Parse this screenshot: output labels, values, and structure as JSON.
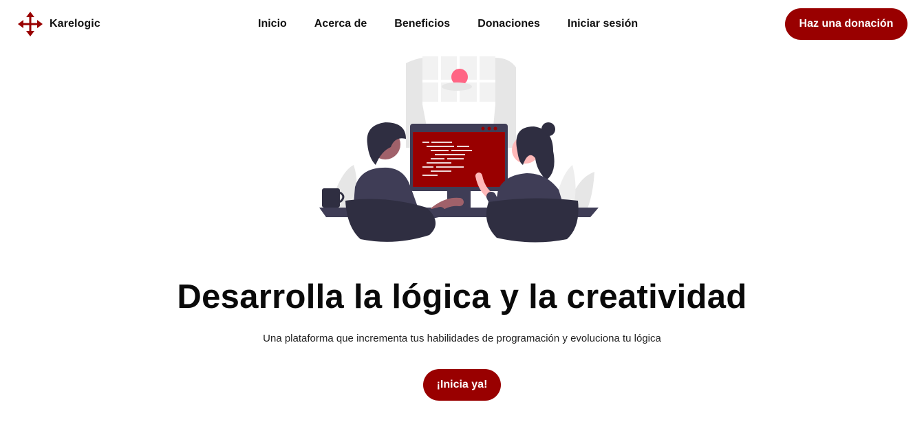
{
  "brand": {
    "name": "Karelogic",
    "logo_icon": "four-arrows-cross-icon",
    "color": "#990000"
  },
  "nav": {
    "items": [
      {
        "label": "Inicio"
      },
      {
        "label": "Acerca de"
      },
      {
        "label": "Beneficios"
      },
      {
        "label": "Donaciones"
      },
      {
        "label": "Iniciar sesión"
      }
    ]
  },
  "header": {
    "donate_label": "Haz una donación"
  },
  "hero": {
    "illustration": "two-programmers-at-computer-illustration",
    "title": "Desarrolla la lógica y la creatividad",
    "subtitle": "Una plataforma que incrementa tus habilidades de programación y evoluciona tu lógica",
    "cta_label": "¡Inicia ya!"
  },
  "colors": {
    "accent": "#990000",
    "text": "#111111",
    "illustration_dark": "#2f2e41",
    "illustration_light": "#e6e6e6",
    "illustration_pink": "#ff6584"
  }
}
